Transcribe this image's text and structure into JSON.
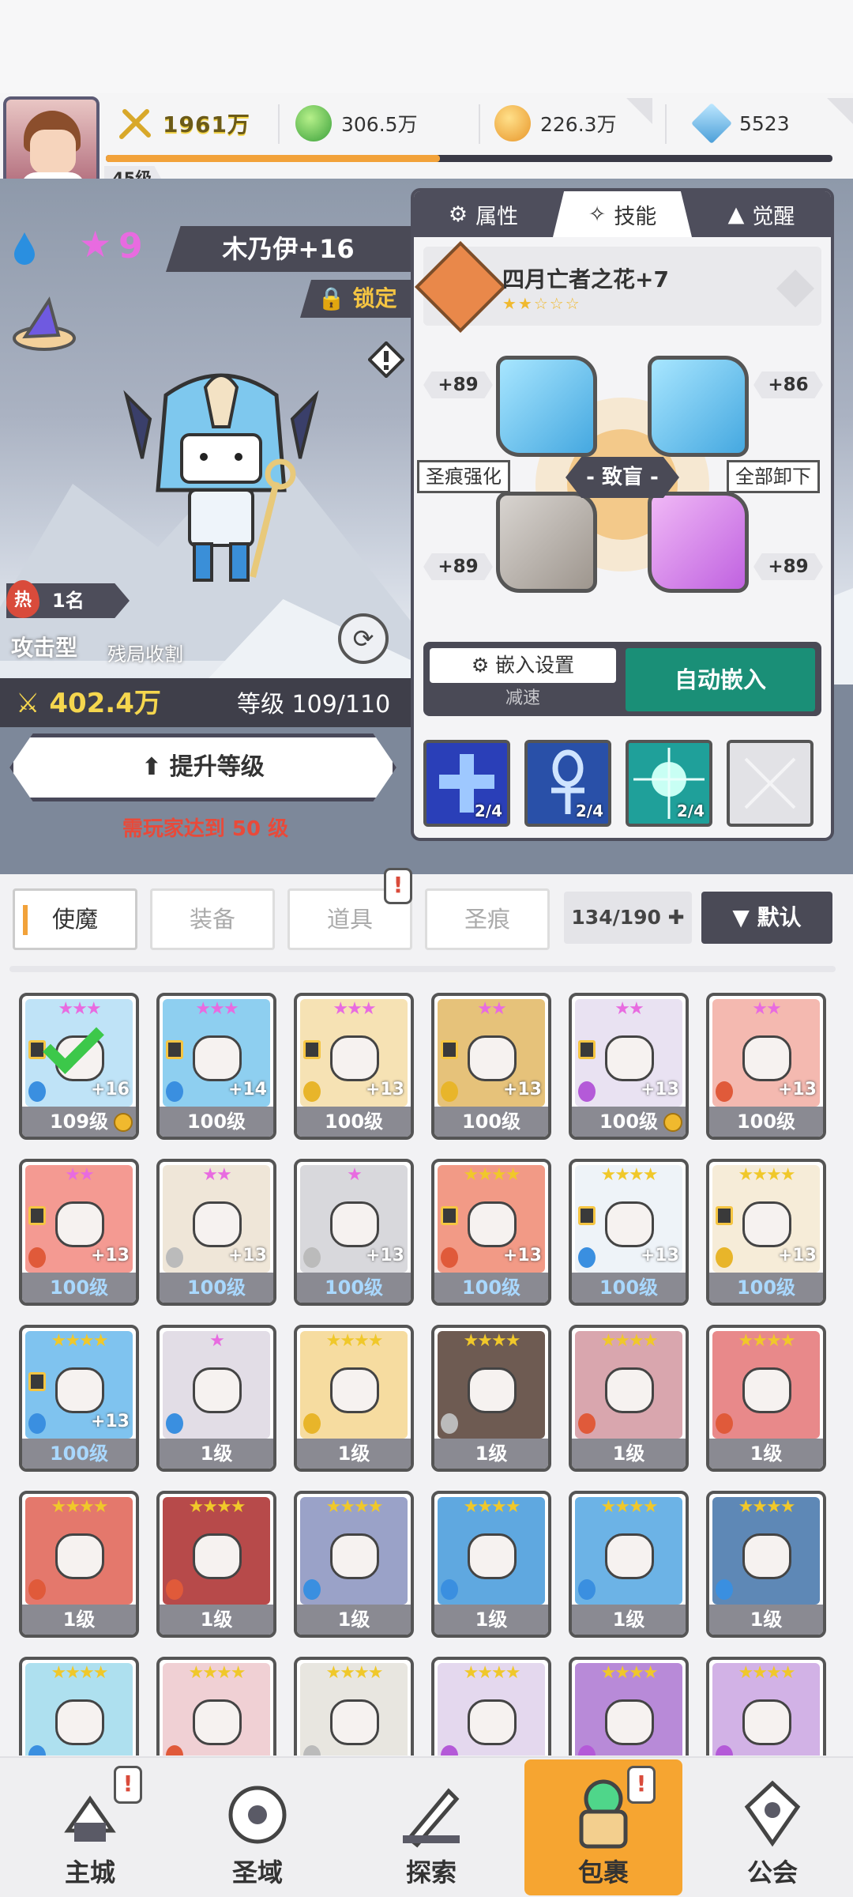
{
  "player": {
    "level": "45级"
  },
  "currency": {
    "power": "1961万",
    "green": "306.5万",
    "gold": "226.3万",
    "gem": "5523",
    "exp_fraction": 0.46
  },
  "hero": {
    "star_count": "9",
    "name": "木乃伊+16",
    "lock_label": "锁定",
    "hot_rank": "1名",
    "hot_icon": "热",
    "type": "攻击型",
    "type_desc": "残局收割",
    "power": "402.4万",
    "level_text": "等级 109/110",
    "upgrade_label": "提升等级",
    "requirement": "需玩家达到 50 级"
  },
  "panel": {
    "tabs": [
      {
        "label": "属性"
      },
      {
        "label": "技能"
      },
      {
        "label": "觉醒"
      }
    ],
    "active_tab": "技能",
    "equip": {
      "name": "四月亡者之花+7",
      "stars": "★★☆☆☆"
    },
    "bonuses": {
      "top_left": "+89",
      "top_right": "+86",
      "bottom_left": "+89",
      "bottom_right": "+89"
    },
    "side_left": "圣痕强化",
    "side_right": "全部卸下",
    "center": "- 致盲 -",
    "embed_settings": "嵌入设置",
    "speed": "减速",
    "auto_embed": "自动嵌入",
    "skills": [
      {
        "count": "2/4",
        "color": "#2a3fb8"
      },
      {
        "count": "2/4",
        "color": "#2950a8"
      },
      {
        "count": "2/4",
        "color": "#1fa09a"
      },
      {
        "count": "",
        "color": "#e2e2e6"
      }
    ]
  },
  "filters": {
    "tabs": [
      "使魔",
      "装备",
      "道具",
      "圣痕"
    ],
    "active": "使魔",
    "count": "134/190",
    "sort_label": "▼ 默认"
  },
  "cards": [
    {
      "stars": "★★★",
      "star_color": "#e86be0",
      "plus": "+16",
      "level": "109级",
      "lock": true,
      "gold": true,
      "check": true,
      "elem": "#3a8fe0",
      "bg": "#bfe3f7",
      "blue": false
    },
    {
      "stars": "★★★",
      "star_color": "#e86be0",
      "plus": "+14",
      "level": "100级",
      "lock": true,
      "gold": false,
      "elem": "#3a8fe0",
      "bg": "#8ecff0",
      "blue": false
    },
    {
      "stars": "★★★",
      "star_color": "#e86be0",
      "plus": "+13",
      "level": "100级",
      "lock": true,
      "gold": false,
      "elem": "#e8b52a",
      "bg": "#f6e2b4",
      "blue": false
    },
    {
      "stars": "★★",
      "star_color": "#e86be0",
      "plus": "+13",
      "level": "100级",
      "lock": true,
      "gold": false,
      "elem": "#e8b52a",
      "bg": "#e6c27a",
      "blue": false
    },
    {
      "stars": "★★",
      "star_color": "#e86be0",
      "plus": "+13",
      "level": "100级",
      "lock": true,
      "gold": true,
      "elem": "#b45ad8",
      "bg": "#e9e2f2",
      "blue": false
    },
    {
      "stars": "★★",
      "star_color": "#e86be0",
      "plus": "+13",
      "level": "100级",
      "lock": false,
      "gold": false,
      "elem": "#e05a3a",
      "bg": "#f4b9b0",
      "blue": false
    },
    {
      "stars": "★★",
      "star_color": "#e86be0",
      "plus": "+13",
      "level": "100级",
      "lock": true,
      "gold": false,
      "elem": "#e05a3a",
      "bg": "#f49a92",
      "blue": true
    },
    {
      "stars": "★★",
      "star_color": "#e86be0",
      "plus": "+13",
      "level": "100级",
      "lock": false,
      "gold": false,
      "elem": "#bbbbbb",
      "bg": "#efe6d8",
      "blue": true
    },
    {
      "stars": "★",
      "star_color": "#e86be0",
      "plus": "+13",
      "level": "100级",
      "lock": false,
      "gold": false,
      "elem": "#bbbbbb",
      "bg": "#d8d8dc",
      "blue": true
    },
    {
      "stars": "★★★★",
      "star_color": "#f0c82a",
      "plus": "+13",
      "level": "100级",
      "lock": true,
      "gold": false,
      "elem": "#e05a3a",
      "bg": "#f29a86",
      "blue": true
    },
    {
      "stars": "★★★★",
      "star_color": "#f0c82a",
      "plus": "+13",
      "level": "100级",
      "lock": true,
      "gold": false,
      "elem": "#3a8fe0",
      "bg": "#eef3f8",
      "blue": true
    },
    {
      "stars": "★★★★",
      "star_color": "#f0c82a",
      "plus": "+13",
      "level": "100级",
      "lock": true,
      "gold": false,
      "elem": "#e8b52a",
      "bg": "#f6ecd8",
      "blue": true
    },
    {
      "stars": "★★★★",
      "star_color": "#f0c82a",
      "plus": "+13",
      "level": "100级",
      "lock": true,
      "gold": false,
      "elem": "#3a8fe0",
      "bg": "#7fc3ef",
      "blue": true
    },
    {
      "stars": "★",
      "star_color": "#e86be0",
      "plus": "",
      "level": "1级",
      "lock": false,
      "gold": false,
      "elem": "#3a8fe0",
      "bg": "#e2dde6",
      "blue": false
    },
    {
      "stars": "★★★★",
      "star_color": "#f0c82a",
      "plus": "",
      "level": "1级",
      "lock": false,
      "gold": false,
      "elem": "#e8b52a",
      "bg": "#f6dca0",
      "blue": false
    },
    {
      "stars": "★★★★",
      "star_color": "#f0c82a",
      "plus": "",
      "level": "1级",
      "lock": false,
      "gold": false,
      "elem": "#bbbbbb",
      "bg": "#6e5b52",
      "blue": false
    },
    {
      "stars": "★★★★",
      "star_color": "#f0c82a",
      "plus": "",
      "level": "1级",
      "lock": false,
      "gold": false,
      "elem": "#e05a3a",
      "bg": "#d9a6ae",
      "blue": false
    },
    {
      "stars": "★★★★",
      "star_color": "#f0c82a",
      "plus": "",
      "level": "1级",
      "lock": false,
      "gold": false,
      "elem": "#e05a3a",
      "bg": "#e8898a",
      "blue": false
    },
    {
      "stars": "★★★★",
      "star_color": "#f0c82a",
      "plus": "",
      "level": "1级",
      "lock": false,
      "gold": false,
      "elem": "#e05a3a",
      "bg": "#e4786c",
      "blue": false
    },
    {
      "stars": "★★★★",
      "star_color": "#f0c82a",
      "plus": "",
      "level": "1级",
      "lock": false,
      "gold": false,
      "elem": "#e05a3a",
      "bg": "#b74a4a",
      "blue": false
    },
    {
      "stars": "★★★★",
      "star_color": "#f0c82a",
      "plus": "",
      "level": "1级",
      "lock": false,
      "gold": false,
      "elem": "#3a8fe0",
      "bg": "#9aa2c8",
      "blue": false
    },
    {
      "stars": "★★★★",
      "star_color": "#f0c82a",
      "plus": "",
      "level": "1级",
      "lock": false,
      "gold": false,
      "elem": "#3a8fe0",
      "bg": "#5fa8e0",
      "blue": false
    },
    {
      "stars": "★★★★",
      "star_color": "#f0c82a",
      "plus": "",
      "level": "1级",
      "lock": false,
      "gold": false,
      "elem": "#3a8fe0",
      "bg": "#6cb3e6",
      "blue": false
    },
    {
      "stars": "★★★★",
      "star_color": "#f0c82a",
      "plus": "",
      "level": "1级",
      "lock": false,
      "gold": false,
      "elem": "#3a8fe0",
      "bg": "#5e88b6",
      "blue": false
    },
    {
      "stars": "★★★★",
      "star_color": "#f0c82a",
      "plus": "",
      "level": "",
      "lock": false,
      "gold": false,
      "elem": "#3a8fe0",
      "bg": "#aee0ef",
      "blue": false
    },
    {
      "stars": "★★★★",
      "star_color": "#f0c82a",
      "plus": "",
      "level": "",
      "lock": false,
      "gold": false,
      "elem": "#e05a3a",
      "bg": "#f0d0d4",
      "blue": false
    },
    {
      "stars": "★★★★",
      "star_color": "#f0c82a",
      "plus": "",
      "level": "",
      "lock": false,
      "gold": false,
      "elem": "#bbbbbb",
      "bg": "#e8e6e0",
      "blue": false
    },
    {
      "stars": "★★★★",
      "star_color": "#f0c82a",
      "plus": "",
      "level": "",
      "lock": false,
      "gold": false,
      "elem": "#b45ad8",
      "bg": "#e4d8ee",
      "blue": false
    },
    {
      "stars": "★★★★",
      "star_color": "#f0c82a",
      "plus": "",
      "level": "",
      "lock": false,
      "gold": false,
      "elem": "#b45ad8",
      "bg": "#b88ad8",
      "blue": false
    },
    {
      "stars": "★★★★",
      "star_color": "#f0c82a",
      "plus": "",
      "level": "",
      "lock": false,
      "gold": false,
      "elem": "#b45ad8",
      "bg": "#d2b2e6",
      "blue": false
    }
  ],
  "nav": [
    {
      "label": "主城",
      "alert": true
    },
    {
      "label": "圣域",
      "alert": false
    },
    {
      "label": "探索",
      "alert": false
    },
    {
      "label": "包裹",
      "alert": true,
      "active": true
    },
    {
      "label": "公会",
      "alert": false
    }
  ],
  "alert_mark": "!"
}
